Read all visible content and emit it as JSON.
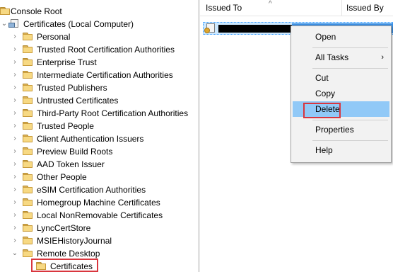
{
  "tree": {
    "root_label": "Console Root",
    "store_label": "Certificates (Local Computer)",
    "stores": [
      {
        "label": "Personal"
      },
      {
        "label": "Trusted Root Certification Authorities"
      },
      {
        "label": "Enterprise Trust"
      },
      {
        "label": "Intermediate Certification Authorities"
      },
      {
        "label": "Trusted Publishers"
      },
      {
        "label": "Untrusted Certificates"
      },
      {
        "label": "Third-Party Root Certification Authorities"
      },
      {
        "label": "Trusted People"
      },
      {
        "label": "Client Authentication Issuers"
      },
      {
        "label": "Preview Build Roots"
      },
      {
        "label": "AAD Token Issuer"
      },
      {
        "label": "Other People"
      },
      {
        "label": "eSIM Certification Authorities"
      },
      {
        "label": "Homegroup Machine Certificates"
      },
      {
        "label": "Local NonRemovable Certificates"
      },
      {
        "label": "LyncCertStore"
      },
      {
        "label": "MSIEHistoryJournal"
      },
      {
        "label": "Remote Desktop"
      }
    ],
    "selected_child_label": "Certificates"
  },
  "list": {
    "columns": [
      "Issued To",
      "Issued By"
    ]
  },
  "context_menu": {
    "items": [
      {
        "label": "Open"
      },
      {
        "label": "All Tasks",
        "submenu_arrow": "›"
      },
      {
        "label": "Cut"
      },
      {
        "label": "Copy"
      },
      {
        "label": "Delete"
      },
      {
        "label": "Properties"
      },
      {
        "label": "Help"
      }
    ],
    "highlighted": "Delete"
  },
  "colors": {
    "highlight_box": "#d9363e",
    "menu_highlight": "#91c9f7",
    "selection": "#cce8ff"
  }
}
